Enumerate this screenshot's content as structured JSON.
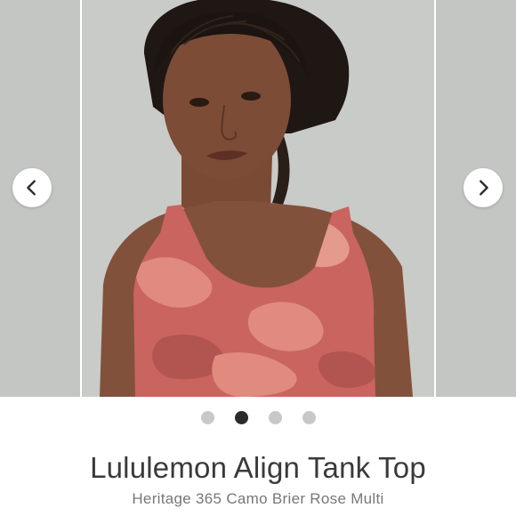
{
  "product": {
    "title": "Lululemon Align Tank Top",
    "subtitle": "Heritage 365 Camo Brier Rose Multi"
  },
  "carousel": {
    "prev_icon": "chevron-left-icon",
    "next_icon": "chevron-right-icon",
    "dot_count": 4,
    "active_index": 1
  },
  "colors": {
    "background": "#ffffff",
    "photo_backdrop": "#c7cac6",
    "camo_primary": "#c9645f",
    "camo_secondary": "#e08a80",
    "dot_active": "#2b2b2b",
    "dot_inactive": "#c8c8c8"
  }
}
